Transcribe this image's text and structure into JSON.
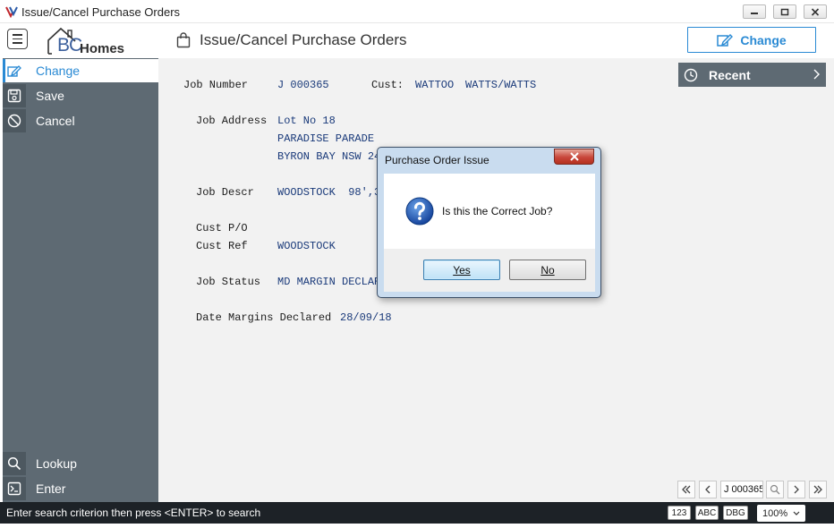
{
  "window": {
    "title": "Issue/Cancel Purchase Orders"
  },
  "header": {
    "logo_bc": "BC",
    "logo_homes": "Homes",
    "page_title": "Issue/Cancel Purchase Orders",
    "change_button": "Change"
  },
  "sidebar": {
    "items": [
      {
        "label": "Change",
        "icon": "edit-icon",
        "active": true
      },
      {
        "label": "Save",
        "icon": "save-icon"
      },
      {
        "label": "Cancel",
        "icon": "cancel-icon"
      }
    ],
    "bottom_items": [
      {
        "label": "Lookup",
        "icon": "search-icon"
      },
      {
        "label": "Enter",
        "icon": "terminal-icon"
      }
    ]
  },
  "recent": {
    "label": "Recent"
  },
  "job": {
    "job_number_label": "Job Number",
    "job_number": "J 000365",
    "cust_label": "Cust:",
    "cust_code": "WATTOO",
    "cust_name": "WATTS/WATTS",
    "address_label": "Job Address",
    "address_lines": [
      "Lot No 18",
      "PARADISE PARADE",
      "BYRON BAY NSW 24"
    ],
    "descr_label": "Job Descr",
    "descr": "WOODSTOCK  98',3",
    "cust_po_label": "Cust P/O",
    "cust_ref_label": "Cust Ref",
    "cust_ref": "WOODSTOCK",
    "status_label": "Job Status",
    "status": "MD MARGIN DECLAR",
    "margins_label": "Date Margins Declared",
    "margins_date": "28/09/18"
  },
  "pager": {
    "value": "J 000365"
  },
  "statusbar": {
    "message": "Enter search criterion then press <ENTER> to search",
    "btn_123": "123",
    "btn_abc": "ABC",
    "btn_dbg": "DBG",
    "zoom": "100%"
  },
  "dialog": {
    "title": "Purchase Order Issue",
    "question": "Is this the Correct Job?",
    "yes": "Yes",
    "no": "No"
  },
  "colors": {
    "accent": "#2a8ad4",
    "sidebar": "#5e6a73",
    "statusbar": "#1d2227",
    "value_text": "#1a3a7a"
  }
}
